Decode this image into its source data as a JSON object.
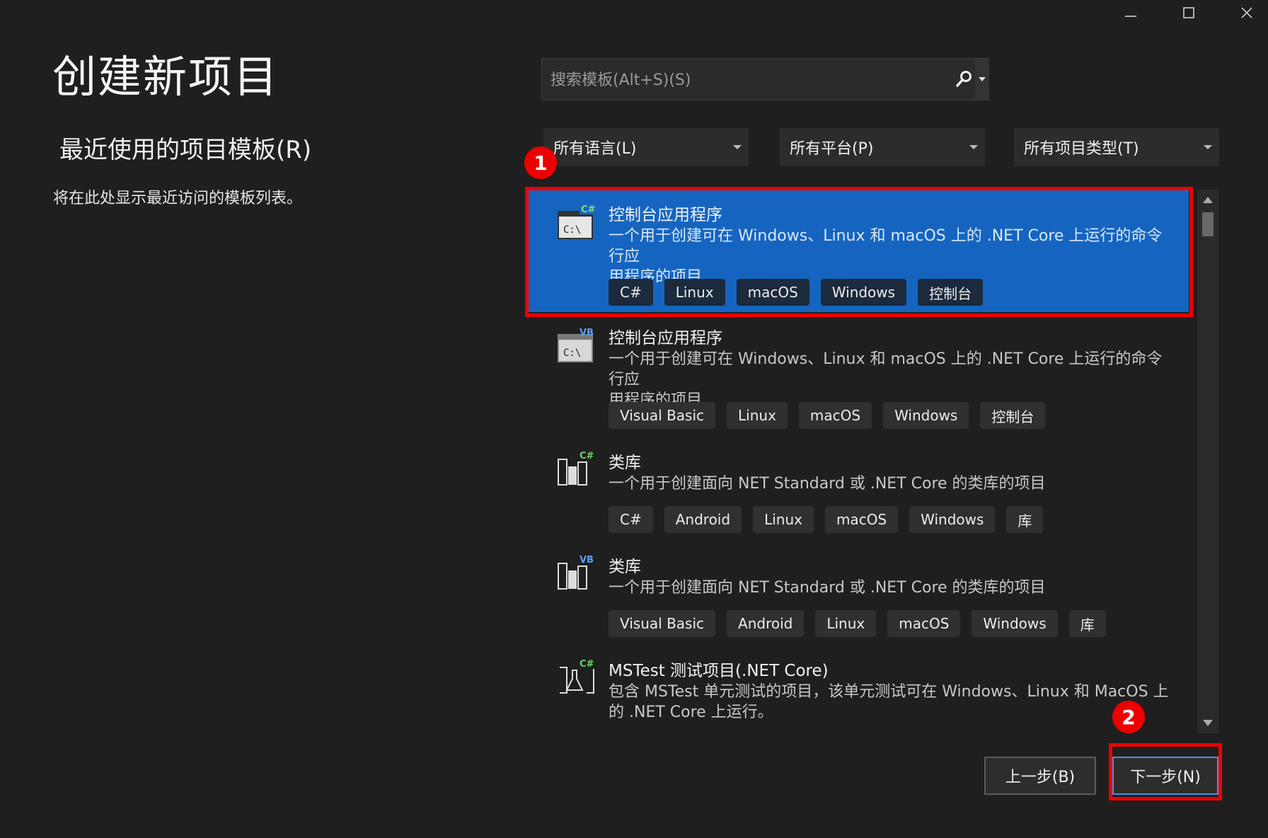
{
  "window_controls": {
    "minimize": "—",
    "maximize": "☐",
    "close": "✕"
  },
  "page_title": "创建新项目",
  "recent": {
    "heading": "最近使用的项目模板(R)",
    "empty_text": "将在此处显示最近访问的模板列表。"
  },
  "search": {
    "placeholder": "搜索模板(Alt+S)(S)",
    "value": ""
  },
  "filters": {
    "language": "所有语言(L)",
    "platform": "所有平台(P)",
    "project_type": "所有项目类型(T)"
  },
  "templates": [
    {
      "title": "控制台应用程序",
      "lang_badge": "C#",
      "icon": "console-app-csharp-icon",
      "desc_line1": "一个用于创建可在 Windows、Linux 和 macOS 上的 .NET Core 上运行的命令行应",
      "desc_line2": "用程序的项目",
      "tags": [
        "C#",
        "Linux",
        "macOS",
        "Windows",
        "控制台"
      ],
      "selected": true
    },
    {
      "title": "控制台应用程序",
      "lang_badge": "VB",
      "icon": "console-app-vb-icon",
      "desc_line1": "一个用于创建可在 Windows、Linux 和 macOS 上的 .NET Core 上运行的命令行应",
      "desc_line2": "用程序的项目",
      "tags": [
        "Visual Basic",
        "Linux",
        "macOS",
        "Windows",
        "控制台"
      ],
      "selected": false
    },
    {
      "title": "类库",
      "lang_badge": "C#",
      "icon": "class-library-csharp-icon",
      "desc_line1": "一个用于创建面向 NET Standard 或 .NET Core 的类库的项目",
      "desc_line2": "",
      "tags": [
        "C#",
        "Android",
        "Linux",
        "macOS",
        "Windows",
        "库"
      ],
      "selected": false
    },
    {
      "title": "类库",
      "lang_badge": "VB",
      "icon": "class-library-vb-icon",
      "desc_line1": "一个用于创建面向 NET Standard 或 .NET Core 的类库的项目",
      "desc_line2": "",
      "tags": [
        "Visual Basic",
        "Android",
        "Linux",
        "macOS",
        "Windows",
        "库"
      ],
      "selected": false
    },
    {
      "title": "MSTest 测试项目(.NET Core)",
      "lang_badge": "C#",
      "icon": "mstest-project-csharp-icon",
      "desc_line1": "包含 MSTest 单元测试的项目，该单元测试可在 Windows、Linux 和 MacOS 上",
      "desc_line2": "的 .NET Core 上运行。",
      "tags": [],
      "selected": false
    }
  ],
  "annotations": {
    "step1": "1",
    "step2": "2"
  },
  "buttons": {
    "back": "上一步(B)",
    "next": "下一步(N)"
  },
  "colors": {
    "background": "#1f1f1f",
    "selected": "#1565c0",
    "highlight": "#e00000"
  }
}
